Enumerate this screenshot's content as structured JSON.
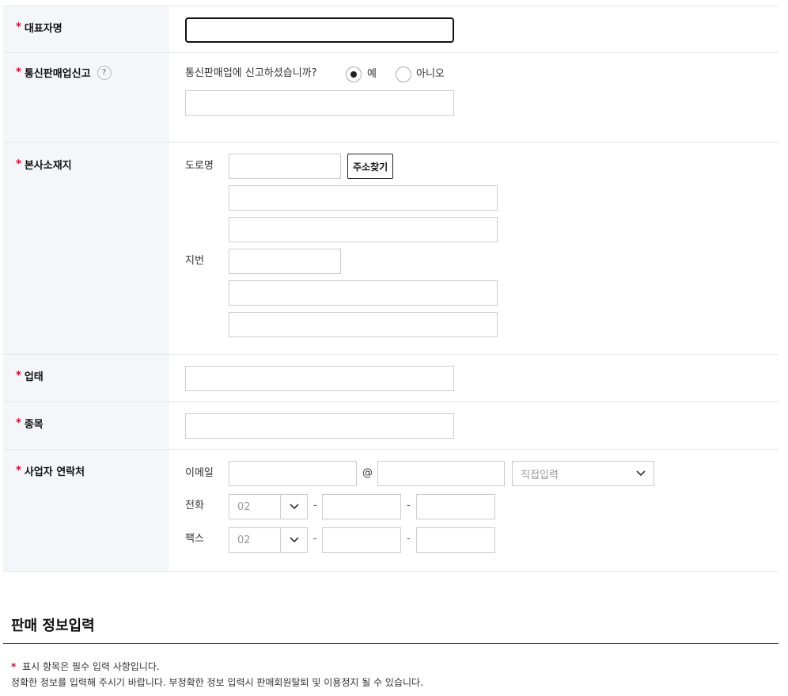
{
  "rows": {
    "representative": {
      "label": "대표자명"
    },
    "telecom": {
      "label": "통신판매업신고",
      "help": "?",
      "question": "통신판매업에 신고하셨습니까?",
      "yes": "예",
      "no": "아니오"
    },
    "address": {
      "label": "본사소재지",
      "road_label": "도로명",
      "search_button": "주소찾기",
      "lot_label": "지번"
    },
    "business_type": {
      "label": "업태"
    },
    "business_item": {
      "label": "종목"
    },
    "contact": {
      "label": "사업자 연락처",
      "email_label": "이메일",
      "at": "@",
      "domain_select": "직접입력",
      "phone_label": "전화",
      "phone_prefix": "02",
      "fax_label": "팩스",
      "fax_prefix": "02",
      "dash": "-"
    }
  },
  "required_mark": "*",
  "sales_section": {
    "title": "판매 정보입력",
    "notice_mark": "*",
    "notice_line1": "표시 항목은 필수 입력 사항입니다.",
    "notice_line2": "정확한 정보를 입력해 주시기 바랍니다. 부정확한 정보 입력시 판매회원탈퇴 및 이용정지 될 수 있습니다."
  }
}
